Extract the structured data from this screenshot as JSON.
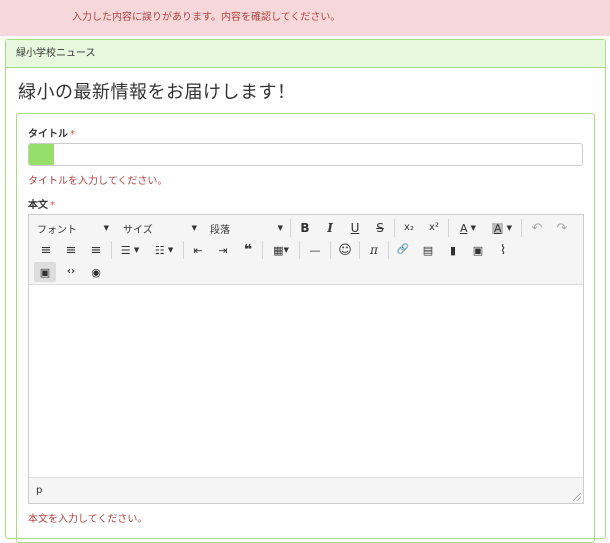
{
  "alert": {
    "message": "入力した内容に誤りがあります。内容を確認してください。"
  },
  "panel": {
    "heading": "緑小学校ニュース"
  },
  "page": {
    "title": "緑小の最新情報をお届けします！"
  },
  "form": {
    "title_label": "タイトル",
    "required_mark": "*",
    "title_error": "タイトルを入力してください。",
    "title_fill_color": "#95df6a",
    "body_label": "本文",
    "body_error": "本文を入力してください。"
  },
  "editor": {
    "font_select": "フォント",
    "size_select": "サイズ",
    "format_select": "段落",
    "statusbar_path": "p",
    "icons": {
      "bold": "B",
      "italic": "I",
      "underline": "U",
      "strike": "S",
      "subscript": "x₂",
      "superscript": "x²",
      "text_color": "A",
      "bg_color": "A",
      "undo": "↶",
      "redo": "↷",
      "align_left": "≡",
      "align_center": "≡",
      "align_right": "≡",
      "bullet_list": "☰",
      "numbered_list": "☷",
      "outdent": "⇤",
      "indent": "⇥",
      "blockquote": "❝",
      "table": "▦",
      "hr": "—",
      "emoticon": "☺",
      "pi": "π",
      "link": "🔗",
      "media": "▤",
      "delete": "▮",
      "image": "▣",
      "attach": "⌇",
      "paste": "▣",
      "code": "‹›",
      "preview": "◉"
    }
  }
}
